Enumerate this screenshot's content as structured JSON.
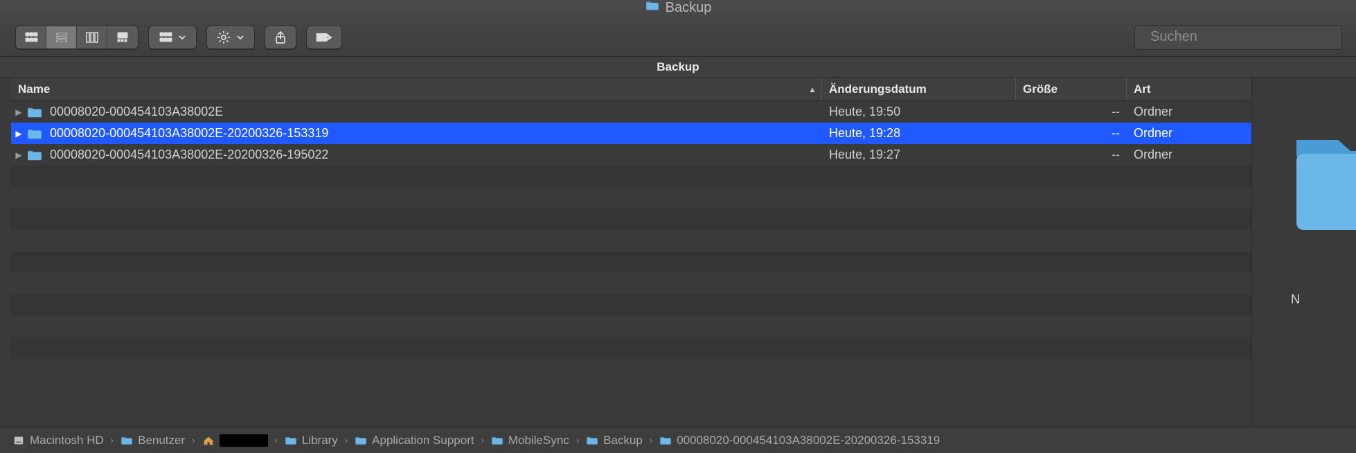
{
  "window": {
    "title": "Backup"
  },
  "toolbar": {
    "view_modes": [
      "grid",
      "list",
      "columns",
      "gallery"
    ],
    "active_view_index": 1
  },
  "search": {
    "placeholder": "Suchen"
  },
  "location_header": "Backup",
  "columns": {
    "name": "Name",
    "date": "Änderungsdatum",
    "size": "Größe",
    "kind": "Art",
    "sort_indicator": "▴"
  },
  "rows": [
    {
      "name": "00008020-000454103A38002E",
      "date": "Heute, 19:50",
      "size": "--",
      "kind": "Ordner",
      "selected": false
    },
    {
      "name": "00008020-000454103A38002E-20200326-153319",
      "date": "Heute, 19:28",
      "size": "--",
      "kind": "Ordner",
      "selected": true
    },
    {
      "name": "00008020-000454103A38002E-20200326-195022",
      "date": "Heute, 19:27",
      "size": "--",
      "kind": "Ordner",
      "selected": false
    }
  ],
  "preview": {
    "caption_prefix": "N"
  },
  "path": {
    "drive": "Macintosh HD",
    "users": "Benutzer",
    "library": "Library",
    "appsupport": "Application Support",
    "mobilesync": "MobileSync",
    "backup": "Backup",
    "leaf": "00008020-000454103A38002E-20200326-153319"
  }
}
